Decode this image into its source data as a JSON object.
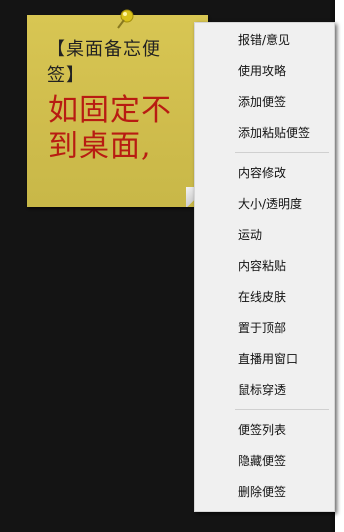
{
  "note": {
    "line1": "【桌面备忘便",
    "line2": "签】",
    "big1": "如固定不",
    "big2": "到桌面,"
  },
  "menu": {
    "group1": [
      "报错/意见",
      "使用攻略",
      "添加便签",
      "添加粘贴便签"
    ],
    "group2": [
      "内容修改",
      "大小/透明度",
      "运动",
      "内容粘贴",
      "在线皮肤",
      "置于顶部",
      "直播用窗口",
      "鼠标穿透"
    ],
    "group3": [
      "便签列表",
      "隐藏便签",
      "删除便签"
    ]
  },
  "colors": {
    "note_bg": "#d8c653",
    "note_red_text": "#b81c12",
    "menu_bg": "#f0f0f0",
    "desktop_bg": "#141414"
  },
  "icons": {
    "pin": "pushpin-icon"
  }
}
